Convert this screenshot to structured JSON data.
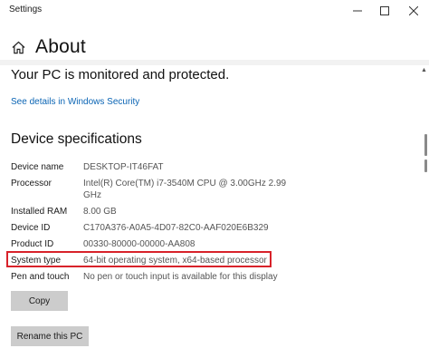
{
  "window": {
    "title": "Settings",
    "minimize_glyph": "—",
    "maximize_glyph": "☐",
    "close_glyph": "✕"
  },
  "header": {
    "icon": "home-icon",
    "title": "About"
  },
  "protection": {
    "status_text": "Your PC is monitored and protected.",
    "link_text": "See details in Windows Security"
  },
  "device_specifications": {
    "title": "Device specifications",
    "rows": [
      {
        "label": "Device name",
        "value": "DESKTOP-IT46FAT"
      },
      {
        "label": "Processor",
        "value": "Intel(R) Core(TM) i7-3540M CPU @ 3.00GHz   2.99 GHz"
      },
      {
        "label": "Installed RAM",
        "value": "8.00 GB"
      },
      {
        "label": "Device ID",
        "value": "C170A376-A0A5-4D07-82C0-AAF020E6B329"
      },
      {
        "label": "Product ID",
        "value": "00330-80000-00000-AA808"
      },
      {
        "label": "System type",
        "value": "64-bit operating system, x64-based processor"
      },
      {
        "label": "Pen and touch",
        "value": "No pen or touch input is available for this display"
      }
    ],
    "highlight_color": "#d8222a"
  },
  "buttons": {
    "copy": "Copy",
    "rename": "Rename this PC"
  },
  "colors": {
    "link": "#0a64b4",
    "button_bg": "#cccccc"
  }
}
